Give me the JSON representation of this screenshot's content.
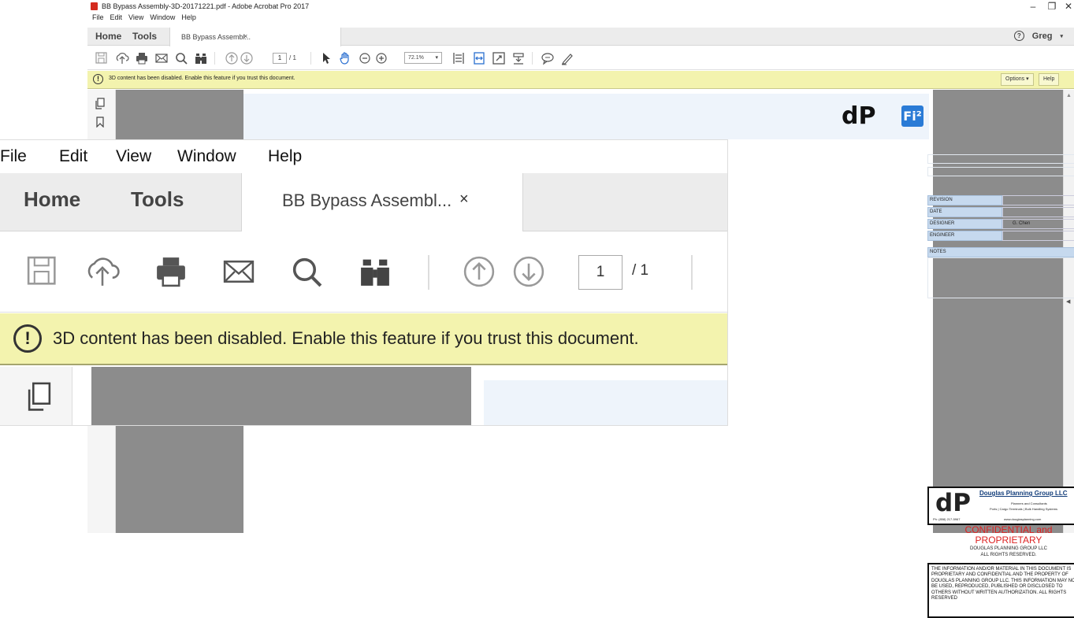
{
  "window": {
    "title": "BB Bypass Assembly-3D-20171221.pdf - Adobe Acrobat Pro 2017",
    "minimize": "–",
    "maximize": "❐",
    "close": "✕"
  },
  "menu": [
    "File",
    "Edit",
    "View",
    "Window",
    "Help"
  ],
  "tabs": {
    "home": "Home",
    "tools": "Tools",
    "document": "BB Bypass Assembl...",
    "close": "×",
    "help_icon": "?",
    "user": "Greg"
  },
  "toolbar": {
    "icons": [
      "save-icon",
      "upload-icon",
      "print-icon",
      "email-icon",
      "search-icon",
      "find-icon",
      "page-up-icon",
      "page-down-icon",
      "select-icon",
      "hand-icon",
      "zoom-out-icon",
      "zoom-in-icon",
      "fit-page-icon",
      "fit-width-icon",
      "fullscreen-icon",
      "stamp-icon",
      "comment-icon",
      "pen-icon"
    ],
    "page_current": "1",
    "page_total": "/ 1",
    "zoom": "72.1%"
  },
  "notification": {
    "message": "3D content has been disabled. Enable this feature if you trust this document.",
    "options": "Options",
    "help": "Help"
  },
  "document": {
    "logo_text": "dP",
    "logo_badge": "Fi²",
    "title_block": [
      {
        "label": "REVISION",
        "value": ""
      },
      {
        "label": "DATE",
        "value": ""
      },
      {
        "label": "DESIGNER",
        "value": "G. Chen"
      },
      {
        "label": "ENGINEER",
        "value": ""
      },
      {
        "label": "NOTES",
        "value": ""
      }
    ],
    "company": {
      "mark": "dP",
      "name": "Douglas Planning Group LLC",
      "tagline": "Planners and Consultants",
      "services": "Ports | Cargo Terminals | Bulk Handling Systems",
      "phone": "Ph: (858) 217-5967",
      "web": "www.douglasplanning.com"
    },
    "confidential": {
      "heading1": "CONFIDENTIAL and",
      "heading2": "PROPRIETARY",
      "line1": "DOUGLAS PLANNING GROUP LLC",
      "line2": "ALL RIGHTS RESERVED."
    },
    "notice": "THE INFORMATION AND/OR MATERIAL IN THIS DOCUMENT IS PROPRIETARY AND CONFIDENTIAL AND THE PROPERTY OF DOUGLAS PLANNING GROUP LLC. THIS INFORMATION MAY NOT BE USED, REPRODUCED, PUBLISHED OR DISCLOSED TO OTHERS WITHOUT WRITTEN AUTHORIZATION. ALL RIGHTS RESERVED"
  }
}
